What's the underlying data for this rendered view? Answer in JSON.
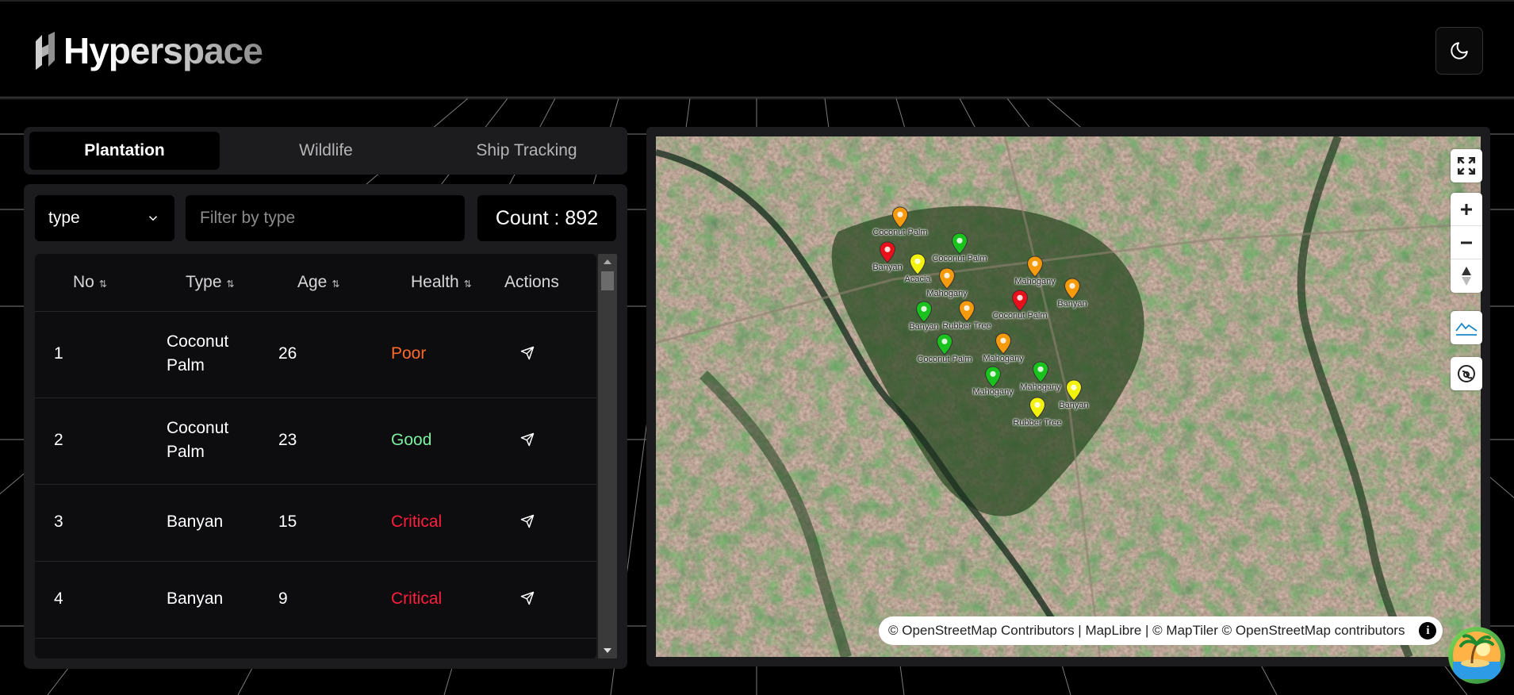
{
  "header": {
    "brand": "Hyperspace",
    "theme_toggle_icon": "moon-icon"
  },
  "tabs": [
    {
      "label": "Plantation",
      "active": true
    },
    {
      "label": "Wildlife",
      "active": false
    },
    {
      "label": "Ship Tracking",
      "active": false
    }
  ],
  "filters": {
    "select_value": "type",
    "filter_placeholder": "Filter by type",
    "count_text": "Count : 892"
  },
  "table": {
    "columns": [
      "No",
      "Type",
      "Age",
      "Health",
      "Actions"
    ],
    "rows": [
      {
        "no": "1",
        "type": "Coconut Palm",
        "age": "26",
        "health": "Poor",
        "health_color": "#ff6a2b"
      },
      {
        "no": "2",
        "type": "Coconut Palm",
        "age": "23",
        "health": "Good",
        "health_color": "#7df0a0"
      },
      {
        "no": "3",
        "type": "Banyan",
        "age": "15",
        "health": "Critical",
        "health_color": "#ff1f3d"
      },
      {
        "no": "4",
        "type": "Banyan",
        "age": "9",
        "health": "Critical",
        "health_color": "#ff1f3d"
      }
    ]
  },
  "map": {
    "markers": [
      {
        "label": "Coconut Palm",
        "color": "#f59a0c"
      },
      {
        "label": "Coconut Palm",
        "color": "#19c21c"
      },
      {
        "label": "Banyan",
        "color": "#e8101a"
      },
      {
        "label": "Acacia",
        "color": "#f2f20c"
      },
      {
        "label": "Mahogany",
        "color": "#f59a0c"
      },
      {
        "label": "Mahogany",
        "color": "#f59a0c"
      },
      {
        "label": "Coconut Palm",
        "color": "#e8101a"
      },
      {
        "label": "Banyan",
        "color": "#f59a0c"
      },
      {
        "label": "Banyan",
        "color": "#19c21c"
      },
      {
        "label": "Rubber Tree",
        "color": "#f59a0c"
      },
      {
        "label": "Coconut Palm",
        "color": "#19c21c"
      },
      {
        "label": "Mahogany",
        "color": "#f59a0c"
      },
      {
        "label": "Mahogany",
        "color": "#19c21c"
      },
      {
        "label": "Mahogany",
        "color": "#19c21c"
      },
      {
        "label": "Banyan",
        "color": "#f2f20c"
      },
      {
        "label": "Rubber Tree",
        "color": "#f2f20c"
      }
    ],
    "controls": [
      "fullscreen-icon",
      "zoom-in-icon",
      "zoom-out-icon",
      "compass-icon",
      "terrain-icon",
      "globe-icon"
    ],
    "attribution": "© OpenStreetMap Contributors | MapLibre | © MapTiler © OpenStreetMap contributors"
  }
}
